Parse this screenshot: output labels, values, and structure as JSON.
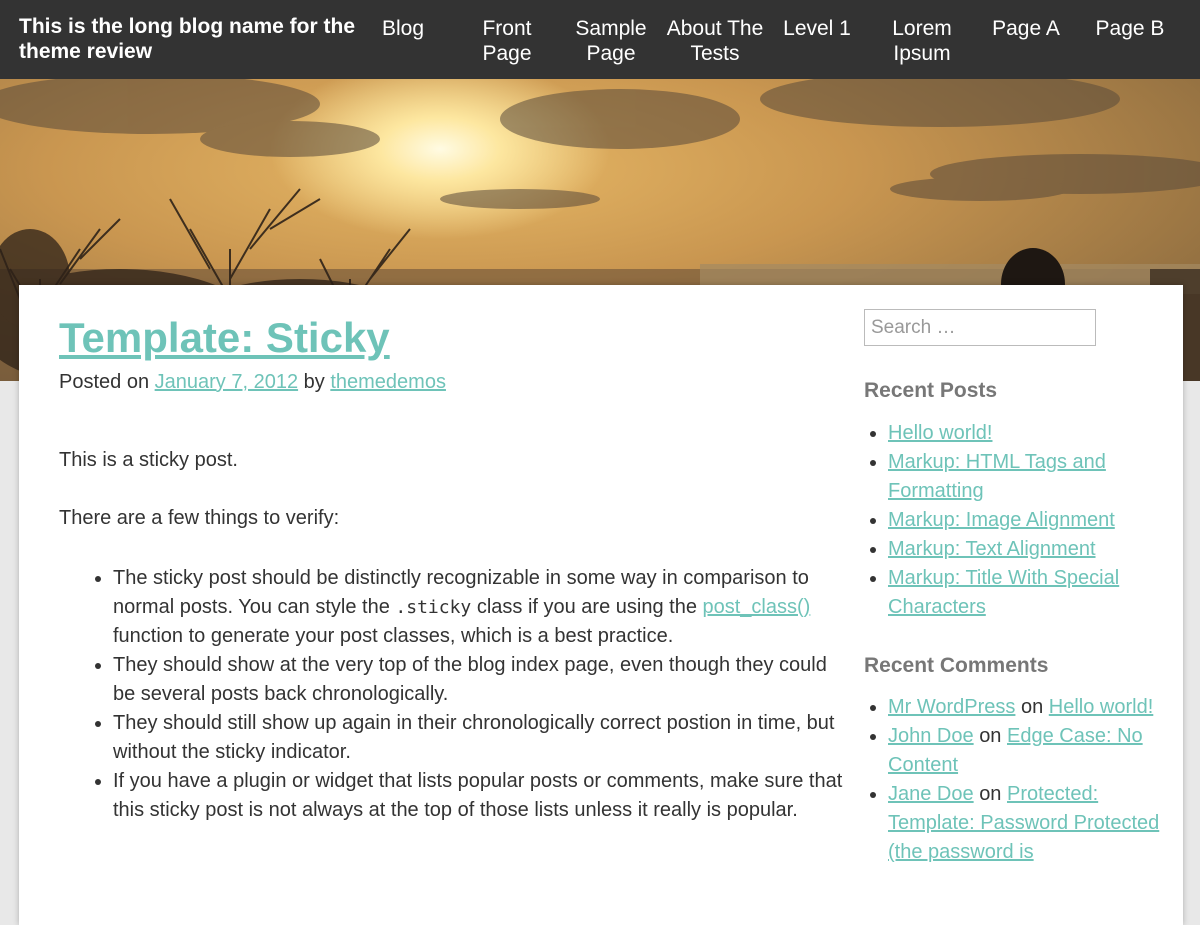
{
  "site": {
    "title": "This is the long blog name for the theme review"
  },
  "nav": [
    {
      "label": "Blog"
    },
    {
      "label": "Front Page"
    },
    {
      "label": "Sample Page"
    },
    {
      "label": "About The Tests"
    },
    {
      "label": "Level 1"
    },
    {
      "label": "Lorem Ipsum"
    },
    {
      "label": "Page A"
    },
    {
      "label": "Page B"
    }
  ],
  "post": {
    "title": "Template: Sticky",
    "posted_on_prefix": "Posted on",
    "date": "January 7, 2012",
    "by": "by",
    "author": "themedemos",
    "paragraphs": [
      "This is a sticky post.",
      "There are a few things to verify:"
    ],
    "bullet1": {
      "part1": "The sticky post should be distinctly recognizable in some way in comparison to normal posts. You can style the ",
      "code": ".sticky",
      "part2": " class if you are using the ",
      "link": "post_class()",
      "part3": " function to generate your post classes, which is a best practice."
    },
    "bullets_rest": [
      "They should show at the very top of the blog index page, even though they could be several posts back chronologically.",
      "They should still show up again in their chronologically correct postion in time, but without the sticky indicator.",
      "If you have a plugin or widget that lists popular posts or comments, make sure that this sticky post is not always at the top of those lists unless it really is popular."
    ]
  },
  "sidebar": {
    "search_placeholder": "Search …",
    "recent_posts_title": "Recent Posts",
    "recent_posts": [
      "Hello world!",
      "Markup: HTML Tags and Formatting",
      "Markup: Image Alignment",
      "Markup: Text Alignment",
      "Markup: Title With Special Characters"
    ],
    "recent_comments_title": "Recent Comments",
    "recent_comments": [
      {
        "author": "Mr WordPress",
        "on": "on",
        "post": "Hello world!"
      },
      {
        "author": "John Doe",
        "on": "on",
        "post": "Edge Case: No Content"
      },
      {
        "author": "Jane Doe",
        "on": "on",
        "post": "Protected: Template: Password Protected (the password is"
      }
    ]
  },
  "colors": {
    "topbar": "#333333",
    "link": "#6ec3b8",
    "widget_title": "#777777"
  }
}
